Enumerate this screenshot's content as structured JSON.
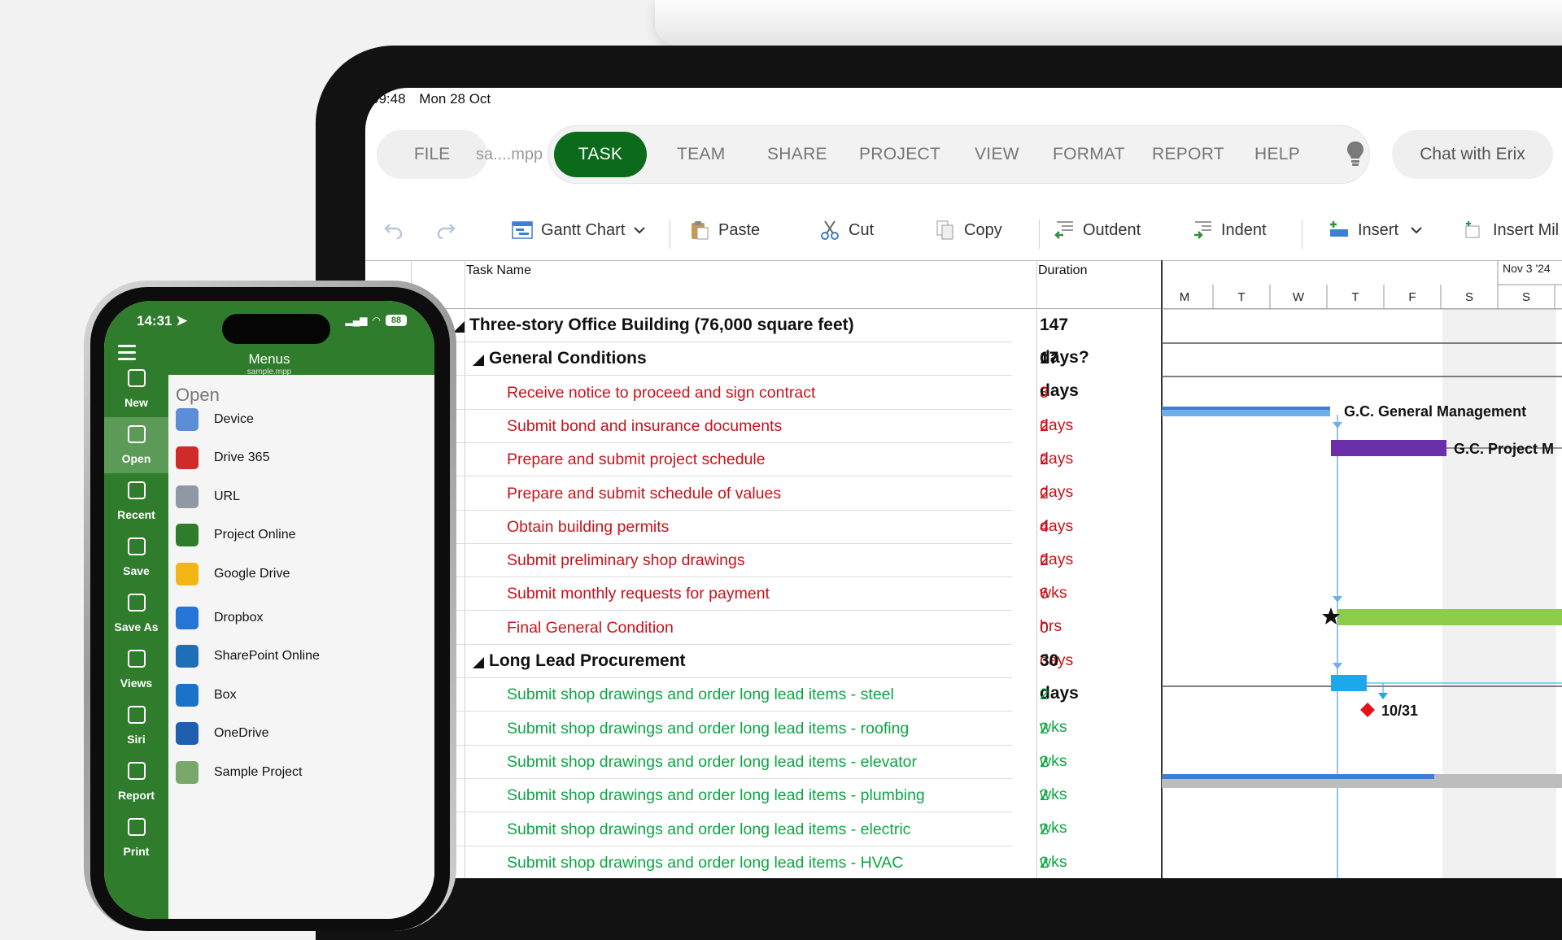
{
  "ipad": {
    "status": {
      "time": "09:48",
      "date": "Mon 28 Oct"
    },
    "file_tab": "FILE",
    "file_name": "sa....mpp",
    "ribbon_tabs": [
      "TASK",
      "TEAM",
      "SHARE",
      "PROJECT",
      "VIEW",
      "FORMAT",
      "REPORT",
      "HELP"
    ],
    "active_tab": "TASK",
    "chat_button": "Chat with Erix",
    "toolbar": {
      "gantt_chart": "Gantt Chart",
      "paste": "Paste",
      "cut": "Cut",
      "copy": "Copy",
      "outdent": "Outdent",
      "indent": "Indent",
      "insert": "Insert",
      "insert_mil": "Insert Mil"
    },
    "grid": {
      "col_task_name": "Task Name",
      "col_duration": "Duration",
      "rows": [
        {
          "name": "Three-story Office Building (76,000 square feet)",
          "duration": "147 days?",
          "level": 0,
          "type": "summary"
        },
        {
          "name": "General Conditions",
          "duration": "17 days",
          "level": 1,
          "type": "summary"
        },
        {
          "name": "Receive notice to proceed and sign contract",
          "duration": "3 days",
          "level": 2,
          "type": "red"
        },
        {
          "name": "Submit bond and insurance documents",
          "duration": "2 days",
          "level": 2,
          "type": "red"
        },
        {
          "name": "Prepare and submit project schedule",
          "duration": "2 days",
          "level": 2,
          "type": "red"
        },
        {
          "name": "Prepare and submit schedule of values",
          "duration": "2 days",
          "level": 2,
          "type": "red"
        },
        {
          "name": "Obtain building permits",
          "duration": "4 days",
          "level": 2,
          "type": "red"
        },
        {
          "name": "Submit preliminary shop drawings",
          "duration": "2 wks",
          "level": 2,
          "type": "red"
        },
        {
          "name": "Submit monthly requests for payment",
          "duration": "6 hrs",
          "level": 2,
          "type": "red"
        },
        {
          "name": "Final General Condition",
          "duration": "0 days",
          "level": 2,
          "type": "red"
        },
        {
          "name": "Long Lead Procurement",
          "duration": "30 days",
          "level": 1,
          "type": "summary"
        },
        {
          "name": "Submit shop drawings and order long lead items - steel",
          "duration": "2 wks",
          "level": 2,
          "type": "green"
        },
        {
          "name": "Submit shop drawings and order long lead items - roofing",
          "duration": "2 wks",
          "level": 2,
          "type": "green"
        },
        {
          "name": "Submit shop drawings and order long lead items - elevator",
          "duration": "2 wks",
          "level": 2,
          "type": "green"
        },
        {
          "name": "Submit shop drawings and order long lead items - plumbing",
          "duration": "2 wks",
          "level": 2,
          "type": "green"
        },
        {
          "name": "Submit shop drawings and order long lead items - electric",
          "duration": "2 wks",
          "level": 2,
          "type": "green"
        },
        {
          "name": "Submit shop drawings and order long lead items - HVAC",
          "duration": "2 wks",
          "level": 2,
          "type": "green"
        }
      ]
    },
    "gantt": {
      "week_label": "Nov 3 '24",
      "days": [
        "M",
        "T",
        "W",
        "T",
        "F",
        "S",
        "S"
      ],
      "labels": {
        "gc_management": "G.C. General Management",
        "gc_project": "G.C. Project M",
        "milestone": "10/31"
      },
      "colors": {
        "light_blue": "#6fb0ea",
        "purple": "#6a2ea8",
        "green": "#8bcc4a",
        "cyan": "#1ba9ec",
        "gray": "#bdbdbd",
        "milestone": "#e3121b"
      }
    }
  },
  "iphone": {
    "status": {
      "time": "14:31",
      "battery": "88"
    },
    "title": "Menus",
    "subtitle": "sample.mpp",
    "side_items": [
      "New",
      "Open",
      "Recent",
      "Save",
      "Save As",
      "Views",
      "Siri",
      "Report",
      "Print"
    ],
    "active_item": "Open",
    "open_title": "Open",
    "sources": [
      "Device",
      "Drive 365",
      "URL",
      "Project Online",
      "Google Drive",
      "Dropbox",
      "SharePoint Online",
      "Box",
      "OneDrive",
      "Sample Project"
    ]
  },
  "accent": {
    "green": "#0b6b1b",
    "phone_green": "#2f7d2c"
  }
}
